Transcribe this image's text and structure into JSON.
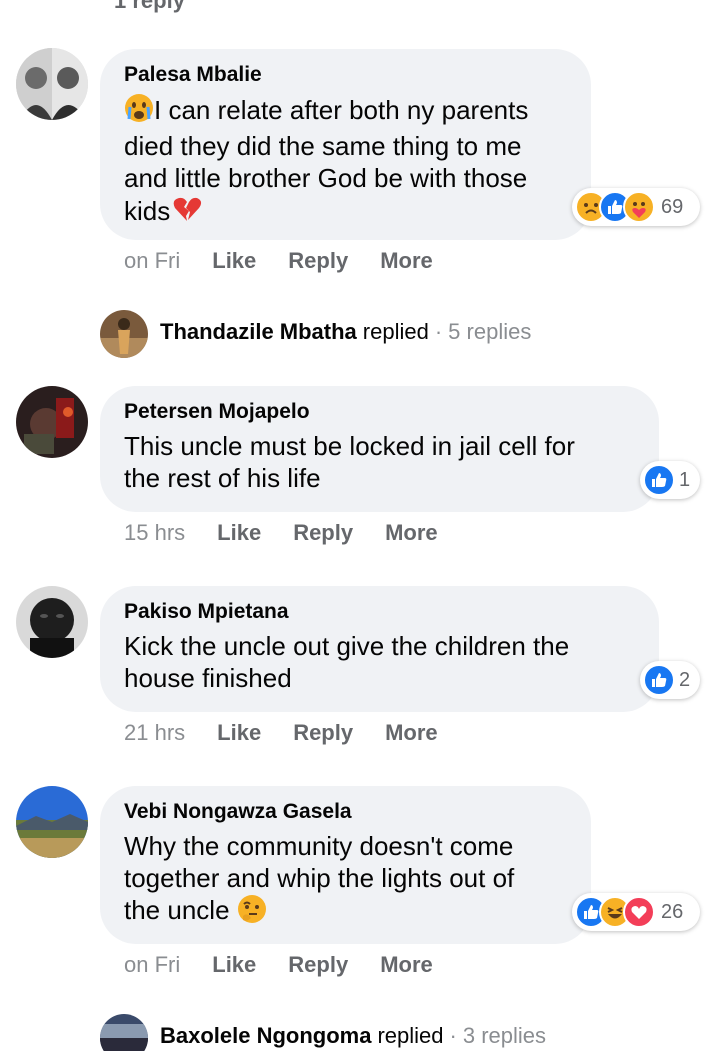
{
  "top": {
    "reply_link": "1 reply"
  },
  "comments": [
    {
      "author": "Palesa Mbalie",
      "text": "I can relate after both ny parents died they did the same thing to me and little brother God be with those kids",
      "line1": "I can relate after both ny parents",
      "line2": "died they did the same thing to me",
      "line3": "and little brother God be with those",
      "line4": "kids",
      "reaction_count": "69",
      "reactions": [
        "sad",
        "like",
        "care"
      ],
      "time": "on Fri",
      "like": "Like",
      "reply": "Reply",
      "more": "More"
    },
    {
      "author": "Petersen Mojapelo",
      "line1": "This uncle must be locked in jail cell for",
      "line2": "the rest of his life",
      "reaction_count": "1",
      "reactions": [
        "like"
      ],
      "time": "15 hrs",
      "like": "Like",
      "reply": "Reply",
      "more": "More"
    },
    {
      "author": "Pakiso Mpietana",
      "line1": "Kick the uncle out give the children the",
      "line2": "house finished",
      "reaction_count": "2",
      "reactions": [
        "like"
      ],
      "time": "21 hrs",
      "like": "Like",
      "reply": "Reply",
      "more": "More"
    },
    {
      "author": "Vebi Nongawza Gasela",
      "line1": "Why the community doesn't come",
      "line2": "together and whip the lights out of",
      "line3": "the uncle",
      "reaction_count": "26",
      "reactions": [
        "like",
        "haha",
        "love"
      ],
      "time": "on Fri",
      "like": "Like",
      "reply": "Reply",
      "more": "More"
    }
  ],
  "replies": [
    {
      "name": "Thandazile Mbatha",
      "word": "replied",
      "dot": "·",
      "count": "5 replies"
    },
    {
      "name": "Baxolele Ngongoma",
      "word": "replied",
      "dot": "·",
      "count": "3 replies"
    }
  ],
  "colors": {
    "like_blue": "#1877f2",
    "love_red": "#f33e58",
    "emoji_yellow": "#f7b125",
    "bubble_bg": "#f0f2f5",
    "meta_gray": "#65676b"
  }
}
